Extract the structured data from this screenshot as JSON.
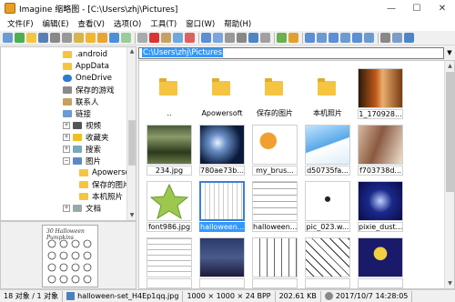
{
  "window": {
    "title": "Imagine 缩略图 - [C:\\Users\\zhj\\Pictures]",
    "minimize": "—",
    "maximize": "☐",
    "close": "✕"
  },
  "menu": [
    "文件(F)",
    "编辑(E)",
    "查看(V)",
    "选项(O)",
    "工具(T)",
    "窗口(W)",
    "帮助(H)"
  ],
  "address": {
    "value": "C:\\Users\\zhj\\Pictures"
  },
  "tree": [
    {
      "label": ".android",
      "icon": "folder-icon"
    },
    {
      "label": "AppData",
      "icon": "folder-icon"
    },
    {
      "label": "OneDrive",
      "icon": "cloud-icon"
    },
    {
      "label": "保存的游戏",
      "icon": "saved-games-icon"
    },
    {
      "label": "联系人",
      "icon": "contacts-icon"
    },
    {
      "label": "链接",
      "icon": "link-icon"
    },
    {
      "label": "视频",
      "icon": "video-icon"
    },
    {
      "label": "收藏夹",
      "icon": "favorites-icon"
    },
    {
      "label": "搜索",
      "icon": "search-icon"
    },
    {
      "label": "图片",
      "icon": "pictures-icon"
    },
    {
      "label": "Apowersoft",
      "icon": "folder-icon"
    },
    {
      "label": "保存的图片",
      "icon": "folder-icon"
    },
    {
      "label": "本机照片",
      "icon": "folder-icon"
    },
    {
      "label": "文档",
      "icon": "documents-icon"
    }
  ],
  "preview": {
    "caption": "30 Halloween Pumpkins"
  },
  "files": [
    {
      "name": "..",
      "type": "folder"
    },
    {
      "name": "Apowersoft",
      "type": "folder"
    },
    {
      "name": "保存的图片",
      "type": "folder"
    },
    {
      "name": "本机照片",
      "type": "folder"
    },
    {
      "name": "1_170928...",
      "type": "image"
    },
    {
      "name": "234.jpg",
      "type": "image"
    },
    {
      "name": "780ae73b...",
      "type": "image"
    },
    {
      "name": "my_brus...",
      "type": "image"
    },
    {
      "name": "d50735fa...",
      "type": "image"
    },
    {
      "name": "f703738d...",
      "type": "image"
    },
    {
      "name": "font986.jpg",
      "type": "image"
    },
    {
      "name": "halloween...",
      "type": "image",
      "selected": true
    },
    {
      "name": "halloween...",
      "type": "image"
    },
    {
      "name": "pic_023.w...",
      "type": "image"
    },
    {
      "name": "pixie_dust...",
      "type": "image"
    },
    {
      "name": "",
      "type": "image"
    },
    {
      "name": "",
      "type": "image"
    },
    {
      "name": "",
      "type": "image"
    },
    {
      "name": "",
      "type": "image"
    },
    {
      "name": "",
      "type": "image"
    }
  ],
  "status": {
    "count": "18 对象 / 1 对象",
    "filename": "halloween-set_H4Ep1qq.jpg",
    "dims": "1000 × 1000 × 24 BPP",
    "size": "202.61 KB",
    "date": "2017/10/7  14:28:05"
  }
}
